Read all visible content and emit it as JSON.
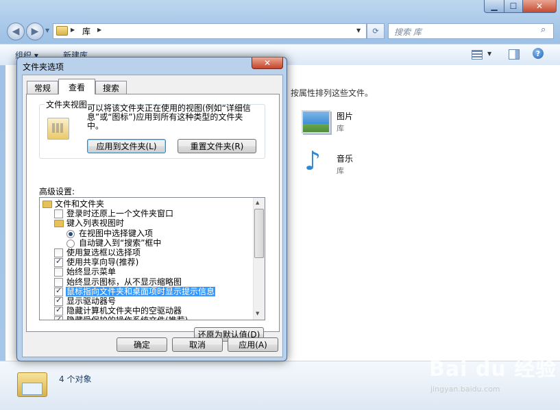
{
  "explorer": {
    "address_crumb": "库",
    "search_placeholder": "搜索 库",
    "organize_label": "组织 ▾",
    "new_library_label": "新建库",
    "hint_text": "按属性排列这些文件。",
    "libraries": [
      {
        "name": "图片",
        "type": "库",
        "icon": "pictures-icon"
      },
      {
        "name": "音乐",
        "type": "库",
        "icon": "music-icon"
      }
    ],
    "status_text": "4 个对象"
  },
  "dialog": {
    "title": "文件夹选项",
    "close_glyph": "✕",
    "tabs": [
      {
        "label": "常规"
      },
      {
        "label": "查看"
      },
      {
        "label": "搜索"
      }
    ],
    "folder_view": {
      "legend": "文件夹视图",
      "description": "可以将该文件夹正在使用的视图(例如“详细信息”或“图标”)应用到所有这种类型的文件夹中。",
      "apply_button": "应用到文件夹(L)",
      "reset_button": "重置文件夹(R)"
    },
    "advanced_label": "高级设置:",
    "tree": [
      {
        "kind": "folder",
        "indent": 0,
        "label": "文件和文件夹"
      },
      {
        "kind": "checkbox",
        "indent": 1,
        "checked": false,
        "label": "登录时还原上一个文件夹窗口"
      },
      {
        "kind": "folder",
        "indent": 1,
        "label": "键入列表视图时"
      },
      {
        "kind": "radio",
        "indent": 2,
        "checked": true,
        "label": "在视图中选择键入项"
      },
      {
        "kind": "radio",
        "indent": 2,
        "checked": false,
        "label": "自动键入到“搜索”框中"
      },
      {
        "kind": "checkbox",
        "indent": 1,
        "checked": false,
        "label": "使用复选框以选择项"
      },
      {
        "kind": "checkbox",
        "indent": 1,
        "checked": true,
        "label": "使用共享向导(推荐)"
      },
      {
        "kind": "checkbox",
        "indent": 1,
        "checked": false,
        "label": "始终显示菜单"
      },
      {
        "kind": "checkbox",
        "indent": 1,
        "checked": false,
        "label": "始终显示图标，从不显示缩略图"
      },
      {
        "kind": "checkbox",
        "indent": 1,
        "checked": true,
        "selected": true,
        "label": "鼠标指向文件夹和桌面项时显示提示信息"
      },
      {
        "kind": "checkbox",
        "indent": 1,
        "checked": true,
        "label": "显示驱动器号"
      },
      {
        "kind": "checkbox",
        "indent": 1,
        "checked": true,
        "label": "隐藏计算机文件夹中的空驱动器"
      },
      {
        "kind": "checkbox",
        "indent": 1,
        "checked": true,
        "label": "隐藏受保护的操作系统文件(推荐)"
      }
    ],
    "restore_defaults_button": "还原为默认值(D)",
    "ok_button": "确定",
    "cancel_button": "取消",
    "apply_main_button": "应用(A)"
  },
  "watermark": {
    "text": "Bai du 经验",
    "url": "jingyan.baidu.com"
  },
  "colors": {
    "selection": "#3399ff",
    "window_frame": "#b9d1ea",
    "close_red": "#c7432a"
  }
}
